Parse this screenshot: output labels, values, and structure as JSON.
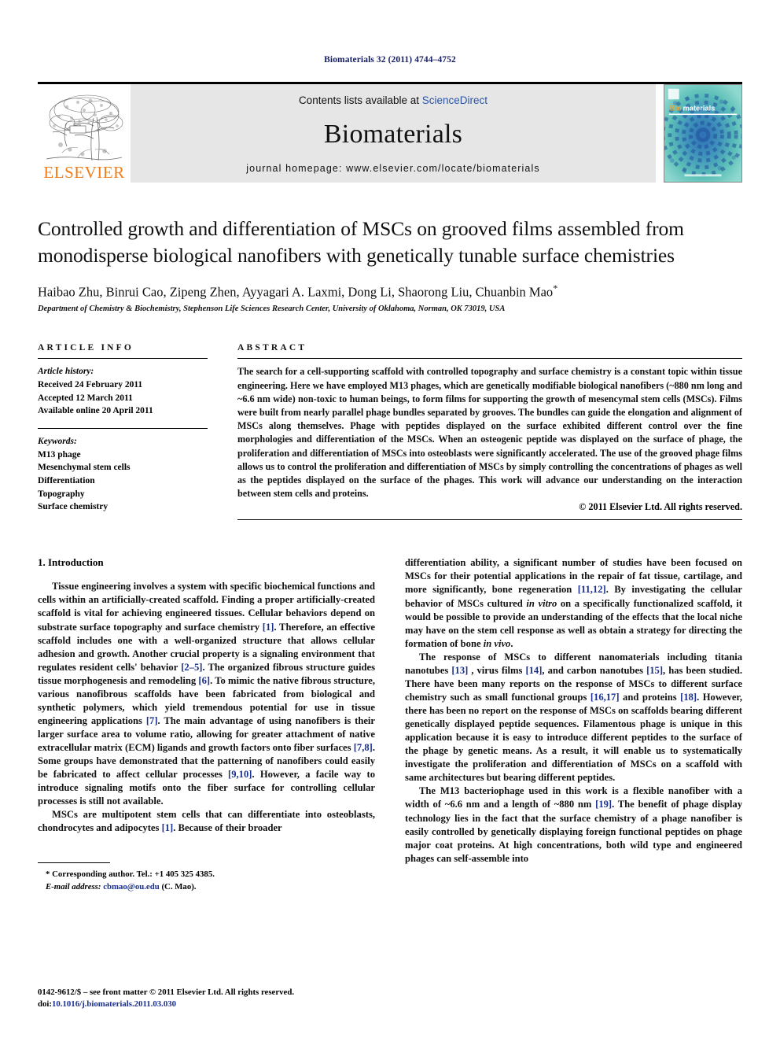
{
  "running_head": "Biomaterials 32 (2011) 4744–4752",
  "masthead": {
    "publisher_wordmark": "ELSEVIER",
    "contents_prefix": "Contents lists available at ",
    "contents_link": "ScienceDirect",
    "journal_title": "Biomaterials",
    "homepage": "journal homepage: www.elsevier.com/locate/biomaterials",
    "cover_brand_prefix": "Bio",
    "cover_brand_suffix": "materials"
  },
  "article": {
    "title": "Controlled growth and differentiation of MSCs on grooved films assembled from monodisperse biological nanofibers with genetically tunable surface chemistries",
    "authors": "Haibao Zhu, Binrui Cao, Zipeng Zhen, Ayyagari A. Laxmi, Dong Li, Shaorong Liu, Chuanbin Mao",
    "corresponding_marker": "*",
    "affiliation": "Department of Chemistry & Biochemistry, Stephenson Life Sciences Research Center, University of Oklahoma, Norman, OK 73019, USA"
  },
  "article_info": {
    "heading": "ARTICLE INFO",
    "history_label": "Article history:",
    "history": [
      "Received 24 February 2011",
      "Accepted 12 March 2011",
      "Available online 20 April 2011"
    ],
    "keywords_label": "Keywords:",
    "keywords": [
      "M13 phage",
      "Mesenchymal stem cells",
      "Differentiation",
      "Topography",
      "Surface chemistry"
    ]
  },
  "abstract": {
    "heading": "ABSTRACT",
    "text": "The search for a cell-supporting scaffold with controlled topography and surface chemistry is a constant topic within tissue engineering. Here we have employed M13 phages, which are genetically modifiable biological nanofibers (~880 nm long and ~6.6 nm wide) non-toxic to human beings, to form films for supporting the growth of mesencymal stem cells (MSCs). Films were built from nearly parallel phage bundles separated by grooves. The bundles can guide the elongation and alignment of MSCs along themselves. Phage with peptides displayed on the surface exhibited different control over the fine morphologies and differentiation of the MSCs. When an osteogenic peptide was displayed on the surface of phage, the proliferation and differentiation of MSCs into osteoblasts were significantly accelerated. The use of the grooved phage films allows us to control the proliferation and differentiation of MSCs by simply controlling the concentrations of phages as well as the peptides displayed on the surface of the phages. This work will advance our understanding on the interaction between stem cells and proteins.",
    "copyright": "© 2011 Elsevier Ltd. All rights reserved."
  },
  "body": {
    "section_number_title": "1. Introduction",
    "left_paragraphs": [
      {
        "parts": [
          {
            "t": "Tissue engineering involves a system with specific biochemical functions and cells within an artificially-created scaffold. Finding a proper artificially-created scaffold is vital for achieving engineered tissues. Cellular behaviors depend on substrate surface topography and surface chemistry "
          },
          {
            "t": "[1]",
            "k": "ref"
          },
          {
            "t": ". Therefore, an effective scaffold includes one with a well-organized structure that allows cellular adhesion and growth. Another crucial property is a signaling environment that regulates resident cells' behavior "
          },
          {
            "t": "[2–5]",
            "k": "ref"
          },
          {
            "t": ". The organized fibrous structure guides tissue morphogenesis and remodeling "
          },
          {
            "t": "[6]",
            "k": "ref"
          },
          {
            "t": ". To mimic the native fibrous structure, various nanofibrous scaffolds have been fabricated from biological and synthetic polymers, which yield tremendous potential for use in tissue engineering applications "
          },
          {
            "t": "[7]",
            "k": "ref"
          },
          {
            "t": ". The main advantage of using nanofibers is their larger surface area to volume ratio, allowing for greater attachment of native extracellular matrix (ECM) ligands and growth factors onto fiber surfaces "
          },
          {
            "t": "[7,8]",
            "k": "ref"
          },
          {
            "t": ". Some groups have demonstrated that the patterning of nanofibers could easily be fabricated to affect cellular processes "
          },
          {
            "t": "[9,10]",
            "k": "ref"
          },
          {
            "t": ". However, a facile way to introduce signaling motifs onto the fiber surface for controlling cellular processes is still not available."
          }
        ]
      },
      {
        "parts": [
          {
            "t": "MSCs are multipotent stem cells that can differentiate into osteoblasts, chondrocytes and adipocytes "
          },
          {
            "t": "[1]",
            "k": "ref"
          },
          {
            "t": ". Because of their broader"
          }
        ]
      }
    ],
    "right_paragraphs": [
      {
        "noindent": true,
        "parts": [
          {
            "t": "differentiation ability, a significant number of studies have been focused on MSCs for their potential applications in the repair of fat tissue, cartilage, and more significantly, bone regeneration "
          },
          {
            "t": "[11,12]",
            "k": "ref"
          },
          {
            "t": ". By investigating the cellular behavior of MSCs cultured "
          },
          {
            "t": "in vitro",
            "k": "ital"
          },
          {
            "t": " on a specifically functionalized scaffold, it would be possible to provide an understanding of the effects that the local niche may have on the stem cell response as well as obtain a strategy for directing the formation of bone "
          },
          {
            "t": "in vivo",
            "k": "ital"
          },
          {
            "t": "."
          }
        ]
      },
      {
        "parts": [
          {
            "t": "The response of MSCs to different nanomaterials including titania nanotubes "
          },
          {
            "t": "[13]",
            "k": "ref"
          },
          {
            "t": " , virus films "
          },
          {
            "t": "[14]",
            "k": "ref"
          },
          {
            "t": ", and carbon nanotubes "
          },
          {
            "t": "[15]",
            "k": "ref"
          },
          {
            "t": ", has been studied. There have been many reports on the response of MSCs to different surface chemistry such as small functional groups "
          },
          {
            "t": "[16,17]",
            "k": "ref"
          },
          {
            "t": " and proteins "
          },
          {
            "t": "[18]",
            "k": "ref"
          },
          {
            "t": ". However, there has been no report on the response of MSCs on scaffolds bearing different genetically displayed peptide sequences. Filamentous phage is unique in this application because it is easy to introduce different peptides to the surface of the phage by genetic means. As a result, it will enable us to systematically investigate the proliferation and differentiation of MSCs on a scaffold with same architectures but bearing different peptides."
          }
        ]
      },
      {
        "parts": [
          {
            "t": "The M13 bacteriophage used in this work is a flexible nanofiber with a width of ~6.6 nm and a length of ~880 nm "
          },
          {
            "t": "[19]",
            "k": "ref"
          },
          {
            "t": ". The benefit of phage display technology lies in the fact that the surface chemistry of a phage nanofiber is easily controlled by genetically displaying foreign functional peptides on phage major coat proteins. At high concentrations, both wild type and engineered phages can self-assemble into"
          }
        ]
      }
    ]
  },
  "footnote": {
    "corresponding": "* Corresponding author. Tel.: +1 405 325 4385.",
    "email_label": "E-mail address:",
    "email": "cbmao@ou.edu",
    "email_suffix": "(C. Mao)."
  },
  "footer": {
    "front_matter": "0142-9612/$ – see front matter © 2011 Elsevier Ltd. All rights reserved.",
    "doi_prefix": "doi:",
    "doi": "10.1016/j.biomaterials.2011.03.030"
  },
  "colors": {
    "link_blue": "#2b55a6",
    "ref_blue": "#1a2f8f",
    "elsevier_orange": "#f07d1a",
    "banner_gray": "#e6e6e6",
    "cover_teal": "#4fb3ac",
    "running_head_blue": "#141c63"
  }
}
